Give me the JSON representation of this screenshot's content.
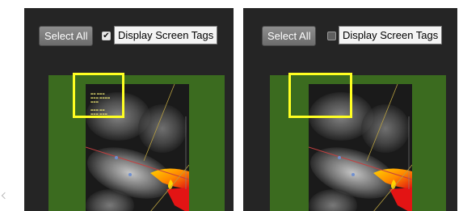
{
  "panels": [
    {
      "select_all_label": "Select All",
      "display_tags_label": "Display Screen Tags",
      "display_tags_checked": true,
      "check_glyph": "✔"
    },
    {
      "select_all_label": "Select All",
      "display_tags_label": "Display Screen Tags",
      "display_tags_checked": false,
      "check_glyph": ""
    }
  ],
  "colors": {
    "panel_bg": "#252525",
    "image_bg": "#3b6b1f",
    "highlight_box": "#ffff22"
  }
}
